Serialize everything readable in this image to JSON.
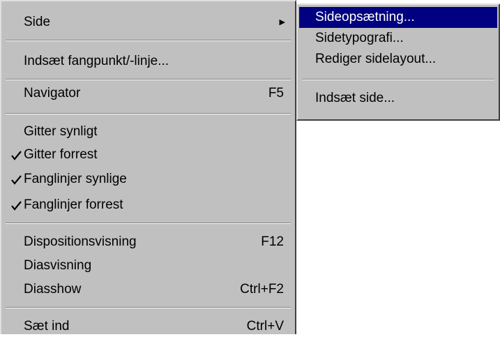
{
  "main_menu": {
    "items": [
      {
        "label": "Side"
      },
      {
        "label": "Indsæt fangpunkt/-linje..."
      },
      {
        "label": "Navigator",
        "shortcut": "F5"
      },
      {
        "label": "Gitter synligt"
      },
      {
        "label": "Gitter forrest",
        "checked": true
      },
      {
        "label": "Fanglinjer synlige",
        "checked": true
      },
      {
        "label": "Fanglinjer forrest",
        "checked": true
      },
      {
        "label": "Dispositionsvisning",
        "shortcut": "F12"
      },
      {
        "label": "Diasvisning"
      },
      {
        "label": "Diasshow",
        "shortcut": "Ctrl+F2"
      },
      {
        "label": "Sæt ind",
        "shortcut": "Ctrl+V"
      }
    ]
  },
  "submenu": {
    "items": [
      {
        "label": "Sideopsætning...",
        "highlighted": true
      },
      {
        "label": "Sidetypografi..."
      },
      {
        "label": "Rediger sidelayout..."
      },
      {
        "label": "Indsæt side..."
      }
    ]
  },
  "colors": {
    "menu_bg": "#c0c0c0",
    "highlight_bg": "#000080",
    "highlight_text": "#ffffff"
  }
}
